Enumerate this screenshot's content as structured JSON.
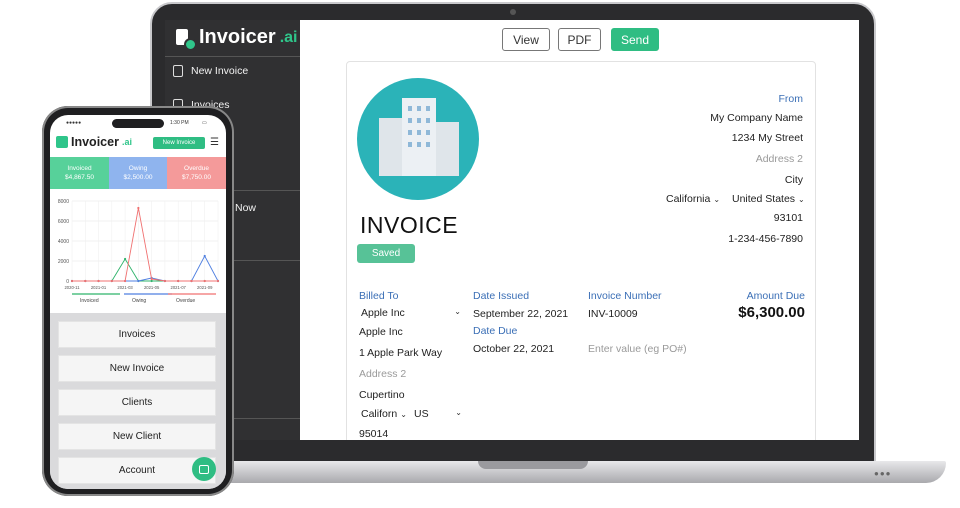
{
  "laptop": {
    "brand": {
      "name": "Invoicer",
      "suffix": ".ai"
    },
    "sidebar": {
      "items": [
        {
          "label": "New Invoice",
          "icon": "file-plus-icon"
        },
        {
          "label": "Invoices",
          "icon": "invoices-icon"
        },
        {
          "label": "nt",
          "icon": ""
        },
        {
          "label": "Now",
          "icon": ""
        }
      ]
    },
    "toolbar": {
      "view_label": "View",
      "pdf_label": "PDF",
      "send_label": "Send"
    },
    "invoice": {
      "title": "INVOICE",
      "status": "Saved",
      "from": {
        "label": "From",
        "company": "My Company Name",
        "street": "1234 My Street",
        "address2_placeholder": "Address 2",
        "city": "City",
        "state": "California",
        "country": "United States",
        "zip": "93101",
        "phone": "1-234-456-7890"
      },
      "billed_to": {
        "label": "Billed To",
        "client_select": "Apple Inc",
        "name": "Apple Inc",
        "street": "1 Apple Park Way",
        "address2_placeholder": "Address 2",
        "city": "Cupertino",
        "state": "Californ",
        "country": "US",
        "zip": "95014"
      },
      "date_issued": {
        "label": "Date Issued",
        "value": "September 22, 2021"
      },
      "date_due": {
        "label": "Date Due",
        "value": "October 22, 2021"
      },
      "invoice_number": {
        "label": "Invoice Number",
        "value": "INV-10009"
      },
      "po_placeholder": "Enter value (eg PO#)",
      "amount_due": {
        "label": "Amount Due",
        "value": "$6,300.00"
      }
    }
  },
  "phone": {
    "status": {
      "time": "1:30 PM"
    },
    "brand": {
      "name": "Invoicer",
      "suffix": ".ai"
    },
    "new_invoice_label": "New Invoice",
    "stats": [
      {
        "label": "Invoiced",
        "value": "$4,867.50",
        "color": "#57d19a"
      },
      {
        "label": "Owing",
        "value": "$2,500.00",
        "color": "#8fb4ee"
      },
      {
        "label": "Overdue",
        "value": "$7,750.00",
        "color": "#f49a9a"
      }
    ],
    "menu": [
      "Invoices",
      "New Invoice",
      "Clients",
      "New Client",
      "Account"
    ],
    "chart_data": {
      "type": "line",
      "x": [
        "2020-11",
        "2021-01",
        "2021-03",
        "2021-05",
        "2021-07",
        "2021-09"
      ],
      "y_ticks": [
        0,
        2000,
        4000,
        6000,
        8000
      ],
      "ylim": [
        0,
        8000
      ],
      "legend": [
        "Invoiced",
        "Owing",
        "Overdue"
      ],
      "series": [
        {
          "name": "Invoiced",
          "color": "#2fb36b",
          "values": [
            0,
            0,
            0,
            0,
            2200,
            0,
            0,
            0,
            0,
            0,
            0,
            0
          ]
        },
        {
          "name": "Owing",
          "color": "#4f7fe0",
          "values": [
            0,
            0,
            0,
            0,
            0,
            0,
            300,
            0,
            0,
            0,
            2500,
            0
          ]
        },
        {
          "name": "Overdue",
          "color": "#f07070",
          "values": [
            0,
            0,
            0,
            0,
            0,
            7300,
            200,
            0,
            0,
            0,
            0,
            0
          ]
        }
      ]
    }
  }
}
